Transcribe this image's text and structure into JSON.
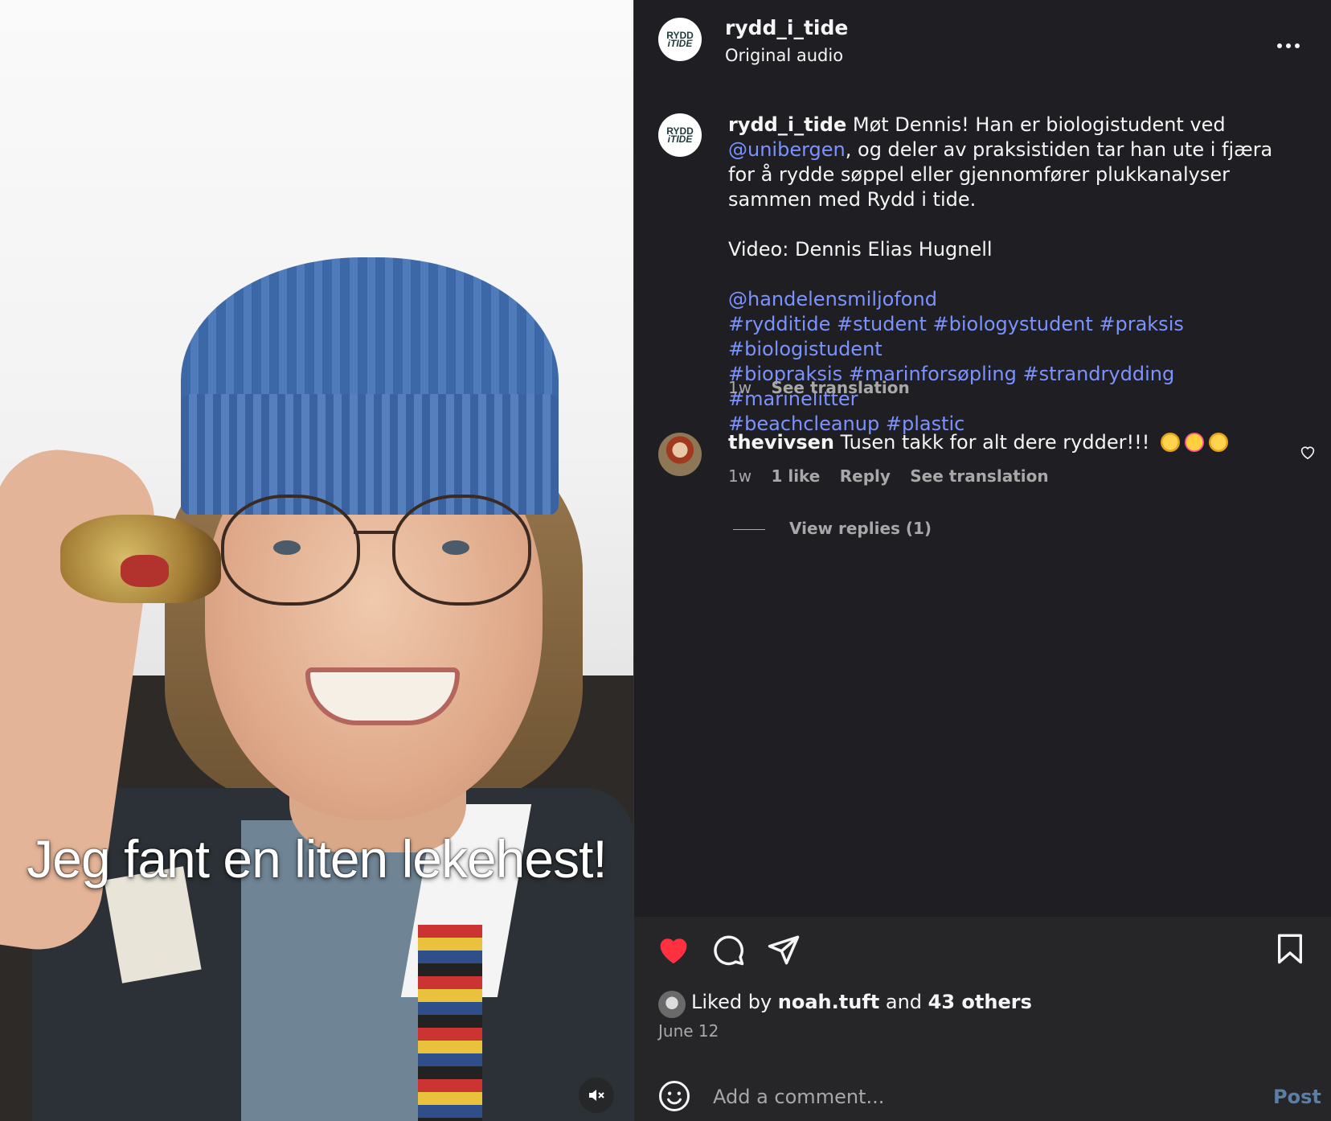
{
  "media": {
    "caption": "Jeg fant en liten lekehest!",
    "mute_icon": "speaker-muted-icon"
  },
  "header": {
    "username": "rydd_i_tide",
    "audio": "Original audio",
    "more_icon": "more-horizontal-icon",
    "logo_line1": "RYDD",
    "logo_line2": "iTIDE"
  },
  "post_caption": {
    "username": "rydd_i_tide",
    "text_part1": " Møt Dennis! Han er biologistudent ved ",
    "mention1": "@unibergen",
    "text_part2": ", og deler av praksistiden tar han ute i fjæra for å rydde søppel eller gjennomfører plukkanalyser sammen med Rydd i tide.",
    "video_credit": "Video: Dennis Elias Hugnell",
    "mention2": "@handelensmiljofond",
    "hashtags_line1": "#rydditide #student #biologystudent #praksis #biologistudent",
    "hashtags_line2": "#biopraksis #marinforsøpling #strandrydding #marinelitter",
    "hashtags_line3": "#beachcleanup #plastic",
    "time": "1w",
    "see_translation": "See translation"
  },
  "comment": {
    "username": "thevivsen",
    "text": " Tusen takk for alt dere rydder!!!",
    "time": "1w",
    "likes": "1 like",
    "reply": "Reply",
    "see_translation": "See translation",
    "view_replies": "View replies (1)"
  },
  "actions": {
    "like_icon": "heart-filled-icon",
    "comment_icon": "comment-icon",
    "share_icon": "send-icon",
    "save_icon": "bookmark-icon",
    "liked_prefix": "Liked by ",
    "liked_user": "noah.tuft",
    "liked_mid": " and ",
    "liked_others": "43 others",
    "date": "June 12"
  },
  "composer": {
    "placeholder": "Add a comment...",
    "post_label": "Post",
    "emoji_icon": "smiley-icon"
  },
  "colors": {
    "panel_bg": "#1f1f23",
    "link": "#7b93ff",
    "heart": "#ff3040",
    "post_button": "#5b7ea6"
  }
}
